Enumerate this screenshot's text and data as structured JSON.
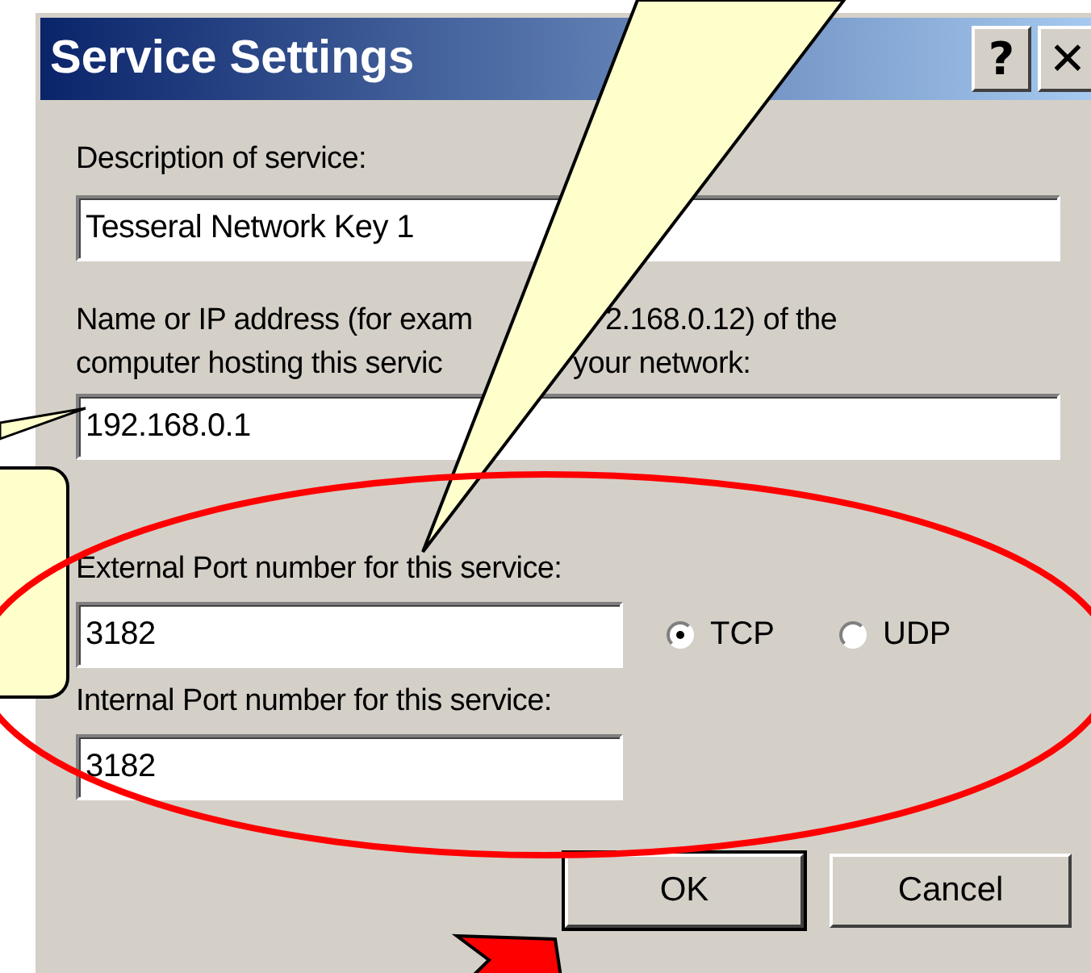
{
  "window": {
    "title": "Service Settings",
    "help_button": "?",
    "close_button": "✕"
  },
  "description": {
    "label": "Description of service:",
    "value": "Tesseral Network Key 1"
  },
  "host": {
    "label_lines": [
      {
        "before": "Name or IP address (for exam",
        "after": "2.168.0.12) of the"
      },
      {
        "before": "computer hosting this servic",
        "after": "your network:"
      }
    ],
    "value": "192.168.0.1"
  },
  "external_port": {
    "label": "External Port number for this service:",
    "value": "3182"
  },
  "protocols": [
    {
      "label": "TCP",
      "selected": true
    },
    {
      "label": "UDP",
      "selected": false
    }
  ],
  "internal_port": {
    "label": "Internal Port number for this service:",
    "value": "3182"
  },
  "buttons": [
    {
      "label": "OK",
      "default": true
    },
    {
      "label": "Cancel",
      "default": false
    }
  ]
}
